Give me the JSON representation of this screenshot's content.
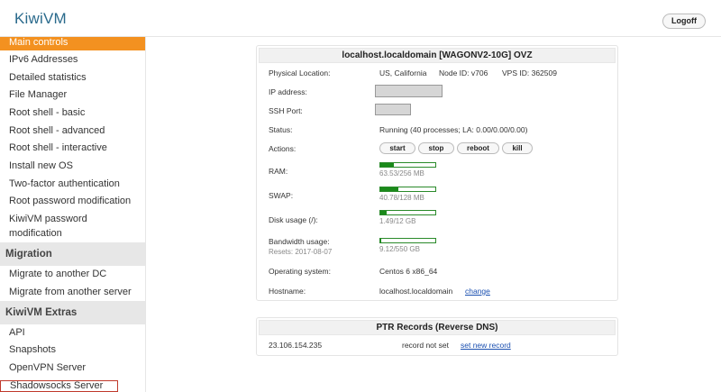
{
  "header": {
    "logo": "KiwiVM",
    "logoff": "Logoff"
  },
  "sidebar": {
    "items": [
      "Main controls",
      "IPv6 Addresses",
      "Detailed statistics",
      "File Manager",
      "Root shell - basic",
      "Root shell - advanced",
      "Root shell - interactive",
      "Install new OS",
      "Two-factor authentication",
      "Root password modification",
      "KiwiVM password",
      "modification"
    ],
    "migration_title": "Migration",
    "migration_items": [
      "Migrate to another DC",
      "Migrate from another server"
    ],
    "extras_title": "KiwiVM Extras",
    "extras_items": [
      "API",
      "Snapshots",
      "OpenVPN Server",
      "Shadowsocks Server"
    ]
  },
  "server": {
    "title": "localhost.localdomain   [WAGONV2-10G]   OVZ",
    "physical_location_label": "Physical Location:",
    "physical_location": "US, California",
    "node_id": "Node ID: v706",
    "vps_id": "VPS ID: 362509",
    "ip_label": "IP address:",
    "ssh_label": "SSH Port:",
    "status_label": "Status:",
    "status": "Running (40 processes; LA: 0.00/0.00/0.00)",
    "actions_label": "Actions:",
    "actions": [
      "start",
      "stop",
      "reboot",
      "kill"
    ],
    "ram_label": "RAM:",
    "ram_text": "63.53/256 MB",
    "ram_fraction": 0.25,
    "swap_label": "SWAP:",
    "swap_text": "40.78/128 MB",
    "swap_fraction": 0.32,
    "disk_label": "Disk usage (/):",
    "disk_text": "1.49/12 GB",
    "disk_fraction": 0.12,
    "bandwidth_label": "Bandwidth usage:",
    "bandwidth_resets": "Resets: 2017-08-07",
    "bandwidth_text": "9.12/550 GB",
    "bandwidth_fraction": 0.017,
    "os_label": "Operating system:",
    "os": "Centos 6 x86_64",
    "hostname_label": "Hostname:",
    "hostname": "localhost.localdomain",
    "change_link": "change"
  },
  "ptr": {
    "title": "PTR Records (Reverse DNS)",
    "ip": "23.106.154.235",
    "status": "record not set",
    "set_link": "set new record"
  },
  "colors": {
    "accent": "#f39120",
    "bar_fill": "#1a8a1a",
    "link": "#1a4fb0"
  }
}
